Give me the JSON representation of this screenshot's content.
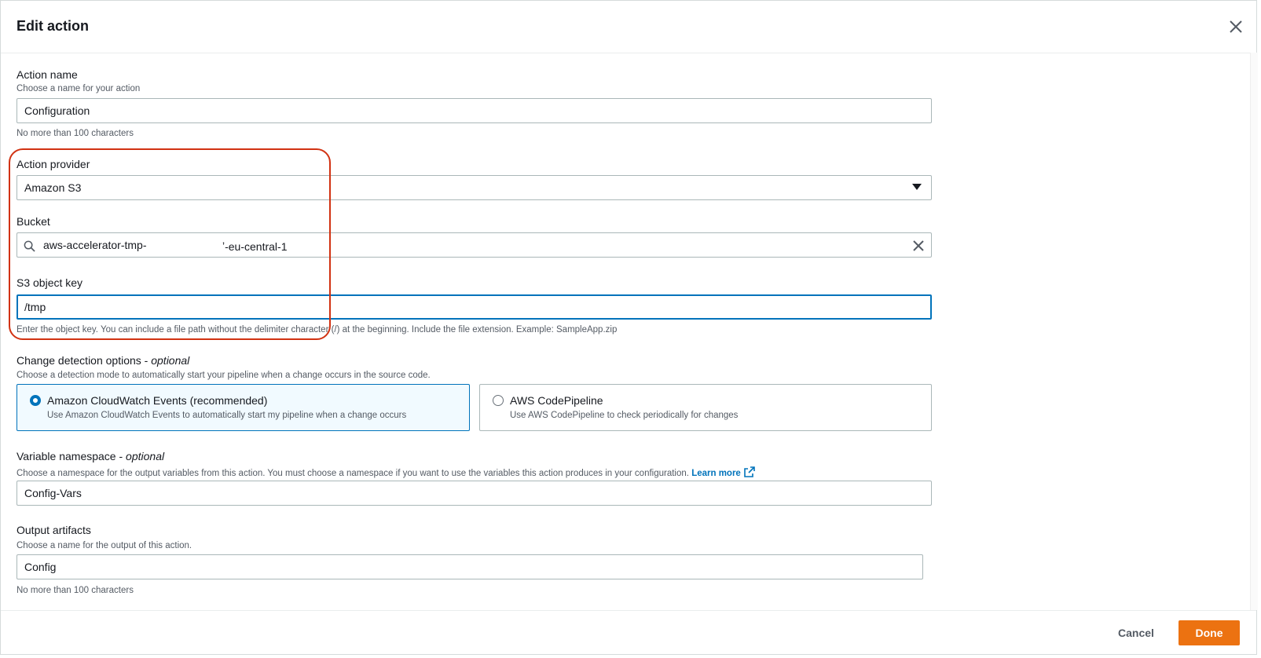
{
  "dialog": {
    "title": "Edit action"
  },
  "action_name": {
    "label": "Action name",
    "description": "Choose a name for your action",
    "value": "Configuration",
    "constraint": "No more than 100 characters"
  },
  "action_provider": {
    "label": "Action provider",
    "value": "Amazon S3"
  },
  "bucket": {
    "label": "Bucket",
    "value_prefix": "aws-accelerator-tmp-",
    "value_suffix": "ʼ-eu-central-1"
  },
  "s3_object_key": {
    "label": "S3 object key",
    "value": "/tmp",
    "help": "Enter the object key. You can include a file path without the delimiter character (/) at the beginning. Include the file extension. Example: SampleApp.zip"
  },
  "change_detection": {
    "label": "Change detection options - ",
    "optional": "optional",
    "description": "Choose a detection mode to automatically start your pipeline when a change occurs in the source code.",
    "options": [
      {
        "title": "Amazon CloudWatch Events (recommended)",
        "description": "Use Amazon CloudWatch Events to automatically start my pipeline when a change occurs",
        "selected": true
      },
      {
        "title": "AWS CodePipeline",
        "description": "Use AWS CodePipeline to check periodically for changes",
        "selected": false
      }
    ]
  },
  "variable_namespace": {
    "label": "Variable namespace - ",
    "optional": "optional",
    "description": "Choose a namespace for the output variables from this action. You must choose a namespace if you want to use the variables this action produces in your configuration.",
    "link_text": "Learn more",
    "value": "Config-Vars"
  },
  "output_artifacts": {
    "label": "Output artifacts",
    "description": "Choose a name for the output of this action.",
    "value": "Config",
    "constraint": "No more than 100 characters"
  },
  "footer": {
    "cancel_label": "Cancel",
    "done_label": "Done"
  },
  "colors": {
    "accent": "#0073bb",
    "primary_button": "#ec7211",
    "highlight": "#d13212"
  },
  "icons": [
    "close-icon",
    "chevron-down-icon",
    "search-icon",
    "clear-icon",
    "external-link-icon"
  ]
}
